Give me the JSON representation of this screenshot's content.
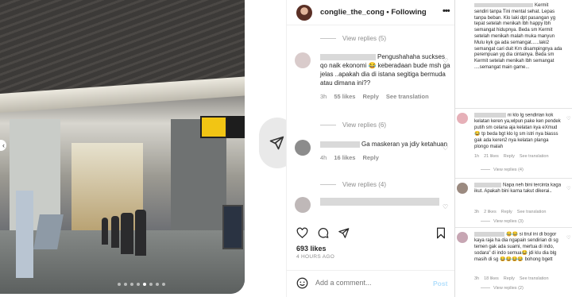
{
  "post": {
    "username": "conglie_the_cong",
    "separator": "•",
    "follow_label": "Following",
    "more_icon": "more-horizontal-icon",
    "likes": "693 likes",
    "time": "4 HOURS AGO",
    "comment_placeholder": "Add a comment...",
    "post_label": "Post"
  },
  "post_comments": [
    {
      "replies_label": "View replies (5)"
    },
    {
      "text": "Pengushahaha suckses qo naik ekonomi 😂 keberadaan bude msh ga jelas ..apakah dia di istana segitiga bermuda atau dimana ini??",
      "time": "3h",
      "likes": "55 likes",
      "reply": "Reply",
      "see_translation": "See translation",
      "replies_label": "View replies (6)"
    },
    {
      "text": "Ga maskeran ya jdiy ketahuan",
      "time": "4h",
      "likes": "16 likes",
      "reply": "Reply",
      "replies_label": "View replies (4)"
    }
  ],
  "right_comments": [
    {
      "text": "Kermit sendiri tanpa Tini mental sehat. Lepas tanpa beban. Klo laki dpt pasangan yg tepat setelah menikah lbh happy lbh semangat hidupnya. Beda sm Kermit setelah menikah malah muka manyun Mulu kyk ga ada semangat......laki2 semangat cari duit Krn disampingnya ada perempuan yg dia cintainya. Beda sm Kermit setelah menikah lbh semangat ....semangat main game..."
    },
    {
      "text": "ni klo lg sendirian kok kelatan keren ya,wlpun pake ken pendek putih sm celana aja kelatan kya eXmud 😂 tp beda bgt klo lg sm istri nya biasss gak ada keren2 nya kelatan planga plongo malah",
      "time": "1h",
      "likes": "21 likes",
      "reply": "Reply",
      "see_translation": "See translation",
      "replies_label": "View replies (4)"
    },
    {
      "text": "Napa neh bini tercinta kaga ikut. Apakah bini karna takut dikerai..",
      "time": "3h",
      "likes": "2 likes",
      "reply": "Reply",
      "see_translation": "See translation",
      "replies_label": "View replies (3)"
    },
    {
      "text": "😂😂 si tirul ini di bogor kaya raja ha dia ngapain sendirian di sg temen gak ada suami, mertua di indo, sodara\" di indo semua😂 jdi klu dia blg masih di sg 😂😂😂😂 bohong bgett",
      "time": "3h",
      "likes": "18 likes",
      "reply": "Reply",
      "see_translation": "See translation",
      "replies_label": "View replies (2)"
    }
  ]
}
